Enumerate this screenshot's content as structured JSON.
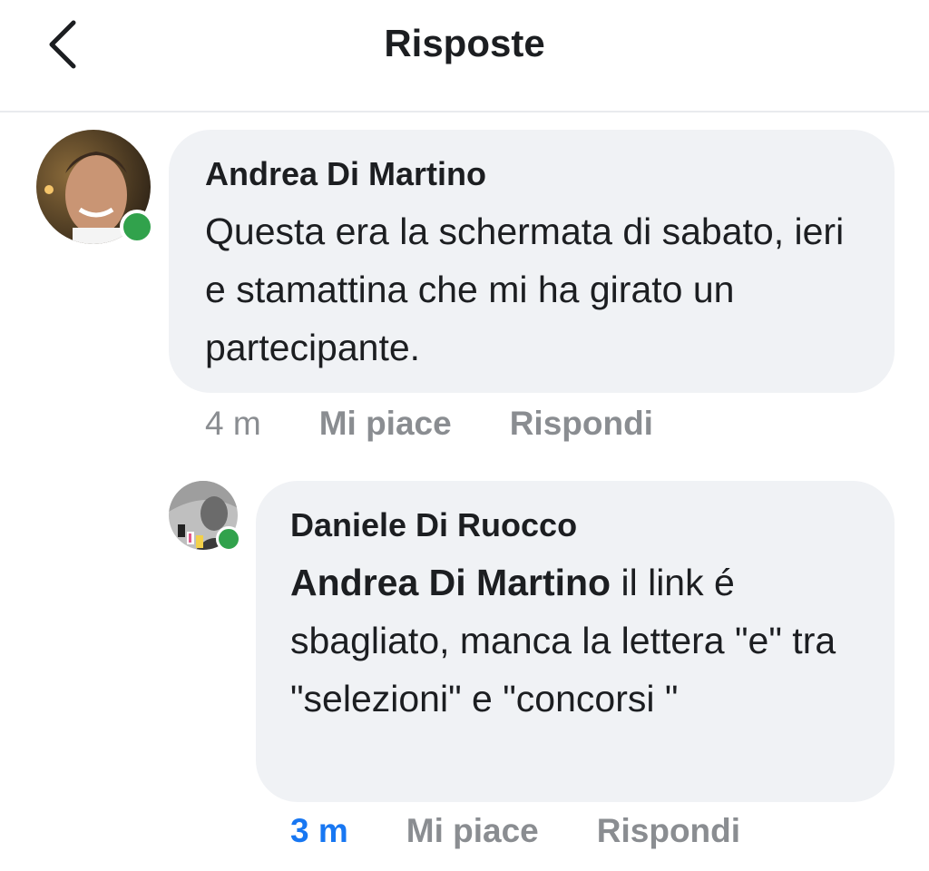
{
  "header": {
    "title": "Risposte"
  },
  "comments": [
    {
      "author": "Andrea Di Martino",
      "text": "Questa era la schermata di sabato, ieri e stamattina che mi ha girato un partecipante.",
      "time": "4 m",
      "like_label": "Mi piace",
      "reply_label": "Rispondi",
      "online": true
    },
    {
      "author": "Daniele Di Ruocco",
      "mention": "Andrea Di Martino",
      "text": " il link é sbagliato, manca la lettera \"e\" tra \"selezioni\" e \"concorsi \"",
      "time": "3 m",
      "like_label": "Mi piace",
      "reply_label": "Rispondi",
      "online": true
    }
  ],
  "colors": {
    "bubble": "#f0f2f5",
    "online": "#31a24c",
    "meta": "#8a8d91",
    "recent_time": "#1877f2"
  }
}
